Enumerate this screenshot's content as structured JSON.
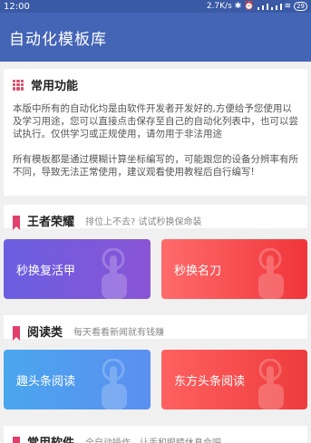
{
  "status_bar": {
    "time": "12:00",
    "speed": "2.7K/s",
    "battery": "29"
  },
  "app_bar": {
    "title": "自动化模板库"
  },
  "intro": {
    "title": "常用功能",
    "para1": "本版中所有的自动化均是由软件开发者开发好的,方便给予您使用以及学习用途，您可以直接点击保存至自己的自动化列表中，也可以尝试执行。仅供学习或正规使用，请勿用于非法用途",
    "para2": "所有模板都是通过模糊计算坐标编写的，可能跟您的设备分辨率有所不同，导致无法正常使用，建议观看使用教程后自行编写!"
  },
  "sections": [
    {
      "title": "王者荣耀",
      "subtitle": "排位上不去? 试试秒换保命装",
      "tiles": [
        "秒换复活甲",
        "秒换名刀"
      ]
    },
    {
      "title": "阅读类",
      "subtitle": "每天看看新闻就有钱赚",
      "tiles": [
        "趣头条阅读",
        "东方头条阅读"
      ]
    },
    {
      "title": "常用软件",
      "subtitle": "全自动操作，让手和眼睛休息会吧"
    }
  ]
}
